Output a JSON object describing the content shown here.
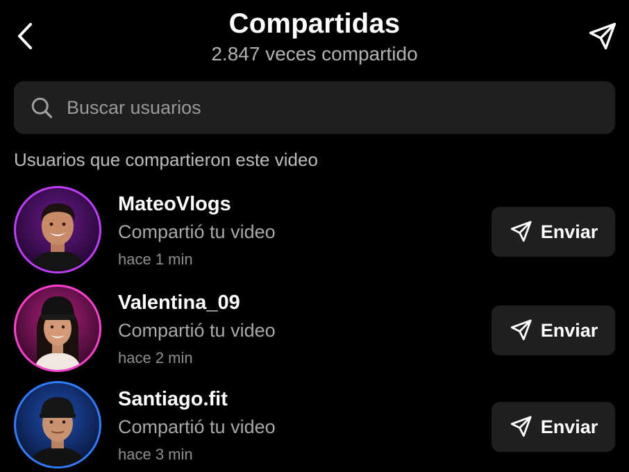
{
  "header": {
    "title": "Compartidas",
    "subtitle": "2.847 veces compartido",
    "back_icon": "chevron-left-icon",
    "share_icon": "paper-plane-icon"
  },
  "search": {
    "placeholder": "Buscar usuarios",
    "value": "",
    "icon": "search-icon"
  },
  "section": {
    "label": "Usuarios que compartieron este video"
  },
  "users": [
    {
      "name": "MateoVlogs",
      "action": "Compartió tu video",
      "time": "hace 1 min",
      "button_label": "Enviar",
      "ring_color": "#c13cff"
    },
    {
      "name": "Valentina_09",
      "action": "Compartió tu video",
      "time": "hace 2 min",
      "button_label": "Enviar",
      "ring_color": "#ff3fd0"
    },
    {
      "name": "Santiago.fit",
      "action": "Compartió tu video",
      "time": "hace 3 min",
      "button_label": "Enviar",
      "ring_color": "#2f7dff"
    }
  ],
  "colors": {
    "background": "#000000",
    "surface": "#1f1f1f",
    "text_primary": "#ffffff",
    "text_secondary": "#a8a8a8"
  }
}
